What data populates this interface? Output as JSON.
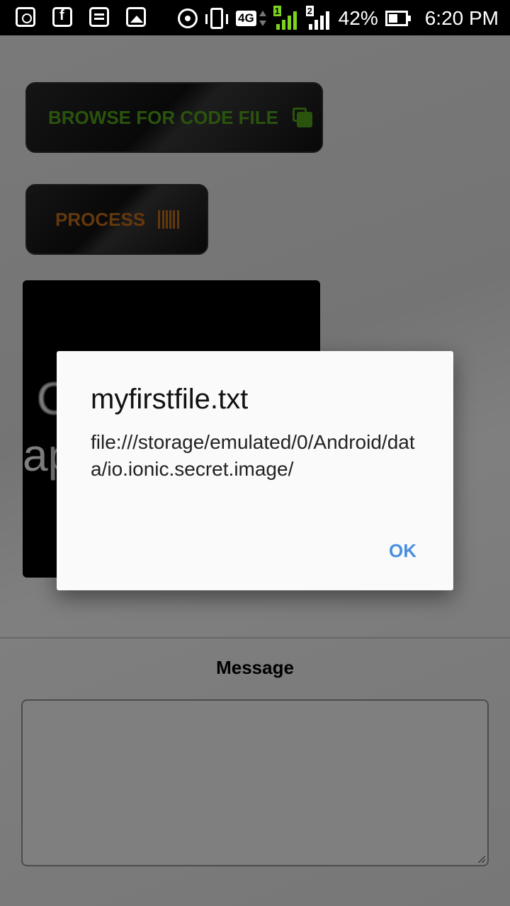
{
  "status_bar": {
    "icons_left": [
      "app-notification-icon",
      "facebook-notification-icon",
      "message-notification-icon",
      "gallery-notification-icon"
    ],
    "network_type": "4G",
    "sim1_label": "1",
    "sim2_label": "2",
    "battery_percent": "42%",
    "time": "6:20 PM"
  },
  "buttons": {
    "browse_label": "BROWSE FOR CODE FILE",
    "process_label": "PROCESS"
  },
  "preview": {
    "line1": "C",
    "line2": "ap"
  },
  "message": {
    "label": "Message",
    "value": ""
  },
  "dialog": {
    "title": "myfirstfile.txt",
    "body": "file:///storage/emulated/0/Android/data/io.ionic.secret.image/",
    "ok_label": "OK"
  },
  "colors": {
    "browse_accent": "#54a81b",
    "process_accent": "#c9701a",
    "dialog_button": "#4a8fe0"
  }
}
